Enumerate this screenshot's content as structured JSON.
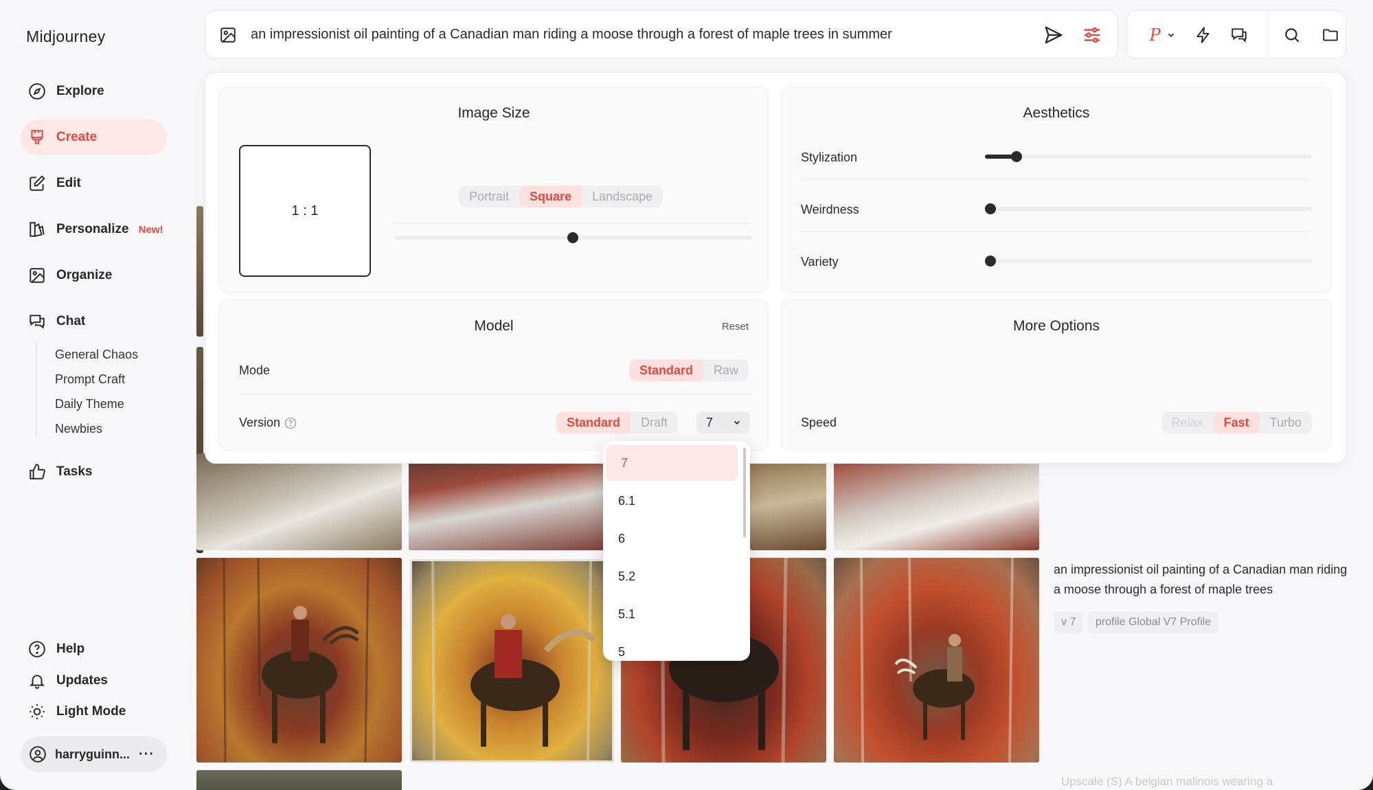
{
  "app": {
    "name": "Midjourney"
  },
  "sidebar": {
    "nav": [
      {
        "label": "Explore",
        "icon": "compass-icon"
      },
      {
        "label": "Create",
        "icon": "brush-icon",
        "active": true
      },
      {
        "label": "Edit",
        "icon": "edit-icon"
      },
      {
        "label": "Personalize",
        "icon": "personalize-icon",
        "badge": "New!"
      },
      {
        "label": "Organize",
        "icon": "image-icon"
      },
      {
        "label": "Chat",
        "icon": "chat-icon"
      }
    ],
    "chat_rooms": [
      "General Chaos",
      "Prompt Craft",
      "Daily Theme",
      "Newbies"
    ],
    "tasks": {
      "label": "Tasks",
      "icon": "thumbs-up-icon"
    },
    "bottom": [
      {
        "label": "Help",
        "icon": "help-icon"
      },
      {
        "label": "Updates",
        "icon": "bell-icon"
      },
      {
        "label": "Light Mode",
        "icon": "sun-icon"
      }
    ],
    "user": {
      "name": "harryguinn...",
      "more": "···"
    }
  },
  "prompt": {
    "text": "an impressionist oil painting of a Canadian man riding a moose through a forest of maple trees in summer"
  },
  "toolbar": {
    "personalize_letter": "P"
  },
  "settings": {
    "image_size": {
      "title": "Image Size",
      "ratio": "1 : 1",
      "options": [
        "Portrait",
        "Square",
        "Landscape"
      ],
      "selected": "Square"
    },
    "aesthetics": {
      "title": "Aesthetics",
      "sliders": [
        {
          "label": "Stylization",
          "value": 0.1
        },
        {
          "label": "Weirdness",
          "value": 0
        },
        {
          "label": "Variety",
          "value": 0
        }
      ]
    },
    "model": {
      "title": "Model",
      "reset": "Reset",
      "mode_label": "Mode",
      "mode_options": [
        "Standard",
        "Raw"
      ],
      "mode_selected": "Standard",
      "version_label": "Version",
      "version_options": [
        "Standard",
        "Draft"
      ],
      "version_selected": "Standard",
      "version_value": "7"
    },
    "more_options": {
      "title": "More Options",
      "speed_label": "Speed",
      "speed_options": [
        "Relax",
        "Fast",
        "Turbo"
      ],
      "speed_selected": "Fast"
    }
  },
  "version_dropdown": {
    "items": [
      "7",
      "6.1",
      "6",
      "5.2",
      "5.1",
      "5"
    ],
    "selected": "7"
  },
  "gallery": {
    "caption": "an impressionist oil painting of a Canadian man riding a moose through a forest of maple trees",
    "tags": [
      "v 7",
      "profile Global V7 Profile"
    ],
    "faded_next": "Upscale (S)    A belgian malinois wearing a"
  },
  "colors": {
    "accent": "#e5493d",
    "accent_bg": "#fde8e7"
  }
}
